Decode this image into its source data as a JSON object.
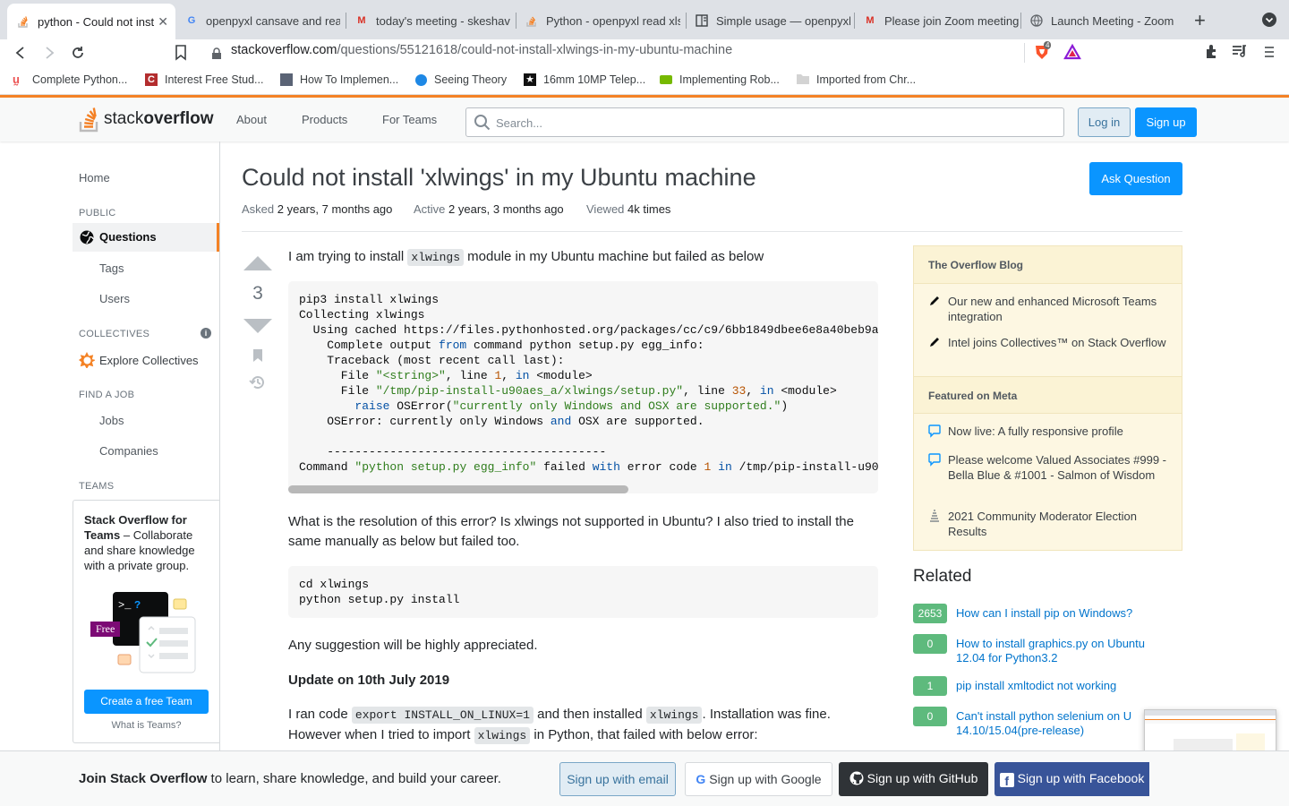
{
  "browser": {
    "tabs": [
      {
        "title": "python - Could not inst",
        "active": true
      },
      {
        "title": "openpyxl cansave and reac"
      },
      {
        "title": "today's meeting - skeshav"
      },
      {
        "title": "Python - openpyxl read xls"
      },
      {
        "title": "Simple usage — openpyxl"
      },
      {
        "title": "Please join Zoom meeting"
      },
      {
        "title": "Launch Meeting - Zoom"
      }
    ],
    "url_domain": "stackoverflow.com",
    "url_path": "/questions/55121618/could-not-install-xlwings-in-my-ubuntu-machine",
    "brave_badge": "4",
    "bookmarks": [
      "Complete Python...",
      "Interest Free Stud...",
      "How To Implemen...",
      "Seeing Theory",
      "16mm 10MP Telep...",
      "Implementing Rob...",
      "Imported from Chr..."
    ]
  },
  "so_header": {
    "logo_a": "stack",
    "logo_b": "overflow",
    "nav": [
      "About",
      "Products",
      "For Teams"
    ],
    "search_placeholder": "Search...",
    "login": "Log in",
    "signup": "Sign up"
  },
  "leftnav": {
    "home": "Home",
    "public": "PUBLIC",
    "questions": "Questions",
    "tags": "Tags",
    "users": "Users",
    "collectives": "COLLECTIVES",
    "explore": "Explore Collectives",
    "findjob": "FIND A JOB",
    "jobs": "Jobs",
    "companies": "Companies",
    "teams": "TEAMS",
    "teams_title": "Stack Overflow for Teams",
    "teams_desc": " – Collaborate and share knowledge with a private group.",
    "free": "Free",
    "create_team": "Create a free Team",
    "what_teams": "What is Teams?"
  },
  "question": {
    "title": "Could not install 'xlwings' in my Ubuntu machine",
    "ask_button": "Ask Question",
    "asked_k": "Asked",
    "asked_v": "2 years, 7 months ago",
    "active_k": "Active",
    "active_v": "2 years, 3 months ago",
    "viewed_k": "Viewed",
    "viewed_v": "4k times",
    "votes": "3",
    "p1a": "I am trying to install ",
    "p1code": "xlwings",
    "p1b": " module in my Ubuntu machine but failed as below",
    "p2": "What is the resolution of this error? Is xlwings not supported in Ubuntu? I also tried to install the same manually as below but failed too.",
    "code2_l1": "cd xlwings",
    "code2_l2": "python setup.py install",
    "p3": "Any suggestion will be highly appreciated.",
    "update": "Update on 10th July 2019",
    "p4a": "I ran code ",
    "p4code1": "export INSTALL_ON_LINUX=1",
    "p4b": " and then installed ",
    "p4code2": "xlwings",
    "p4c": ". Installation was fine.",
    "p4d": "However when I tried to import ",
    "p4code3": "xlwings",
    "p4e": " in Python, that failed with below error:"
  },
  "code1": {
    "l1": "pip3 install xlwings",
    "l2": "Collecting xlwings",
    "l3": "  Using cached https://files.pythonhosted.org/packages/cc/c9/6bb1849dbee6e8a40beb9a",
    "l4a": "    Complete output ",
    "l4b": "from",
    "l4c": " command python setup.py egg_info:",
    "l5": "    Traceback (most recent call last):",
    "l6a": "      File ",
    "l6b": "\"<string>\"",
    "l6c": ", line ",
    "l6d": "1",
    "l6e": ", ",
    "l6f": "in",
    "l6g": " <module>",
    "l7a": "      File ",
    "l7b": "\"/tmp/pip-install-u90aes_a/xlwings/setup.py\"",
    "l7c": ", line ",
    "l7d": "33",
    "l7e": ", ",
    "l7f": "in",
    "l7g": " <module>",
    "l8a": "        ",
    "l8b": "raise",
    "l8c": " OSError(",
    "l8d": "\"currently only Windows and OSX are supported.\"",
    "l8e": ")",
    "l9a": "    OSError: currently only Windows ",
    "l9b": "and",
    "l9c": " OSX are supported.",
    "l10": "    ----------------------------------------",
    "l11a": "Command ",
    "l11b": "\"python setup.py egg_info\"",
    "l11c": " failed ",
    "l11d": "with",
    "l11e": " error code ",
    "l11f": "1",
    "l11g": " ",
    "l11h": "in",
    "l11i": " /tmp/pip-install-u90"
  },
  "blog": {
    "head1": "The Overflow Blog",
    "b1": "Our new and enhanced Microsoft Teams integration",
    "b2": "Intel joins Collectives™ on Stack Overflow",
    "head2": "Featured on Meta",
    "m1": "Now live: A fully responsive profile",
    "m2": "Please welcome Valued Associates #999 - Bella Blue & #1001 - Salmon of Wisdom",
    "m3": "2021 Community Moderator Election Results"
  },
  "related": {
    "heading": "Related",
    "items": [
      {
        "count": "2653",
        "title": "How can I install pip on Windows?"
      },
      {
        "count": "0",
        "title": "How to install graphics.py on Ubuntu 12.04 for Python3.2"
      },
      {
        "count": "1",
        "title": "pip install xmltodict not working"
      },
      {
        "count": "0",
        "title": "Can't install python selenium on U 14.10/15.04(pre-release)"
      }
    ]
  },
  "banner": {
    "bold": "Join Stack Overflow",
    "rest": " to learn, share knowledge, and build your career.",
    "email": "Sign up with email",
    "google": "Sign up with Google",
    "github": "Sign up with GitHub",
    "facebook": "Sign up with Facebook"
  }
}
